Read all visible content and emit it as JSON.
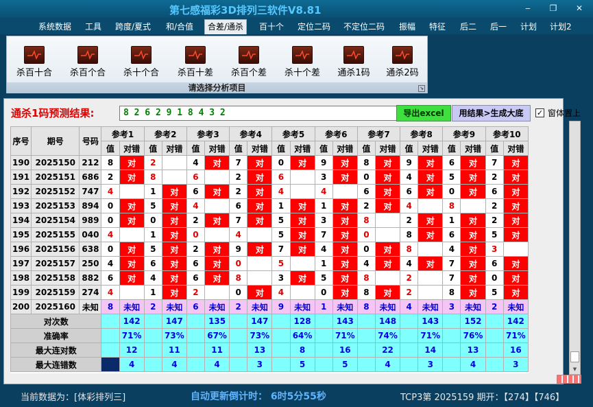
{
  "window": {
    "title": "第七感福彩3D排列三软件V8.81",
    "min_glyph": "‒",
    "restore_glyph": "❐",
    "close_glyph": "✕"
  },
  "menu": [
    {
      "label": "系统数据"
    },
    {
      "label": "工具"
    },
    {
      "label": "跨度/夏式"
    },
    {
      "label": "和/合值"
    },
    {
      "label": "合差/通杀",
      "active": true
    },
    {
      "label": "百十个"
    },
    {
      "label": "定位二码"
    },
    {
      "label": "不定位二码"
    },
    {
      "label": "振幅"
    },
    {
      "label": "特征"
    },
    {
      "label": "后二"
    },
    {
      "label": "后一"
    },
    {
      "label": "计划"
    },
    {
      "label": "计划2"
    }
  ],
  "ribbon": {
    "buttons": [
      {
        "label": "杀百十合",
        "icon": "chart-icon"
      },
      {
        "label": "杀百个合",
        "icon": "chart-icon"
      },
      {
        "label": "杀十个合",
        "icon": "chart-icon"
      },
      {
        "label": "杀百十差",
        "icon": "chart-icon"
      },
      {
        "label": "杀百个差",
        "icon": "chart-icon"
      },
      {
        "label": "杀十个差",
        "icon": "chart-icon"
      },
      {
        "label": "通杀1码",
        "icon": "chart-icon"
      },
      {
        "label": "通杀2码",
        "icon": "chart-icon"
      }
    ],
    "group_label": "请选择分析项目",
    "launcher_glyph": "↘"
  },
  "prediction": {
    "label": "通杀1码预测结果:",
    "value": "8  2  6  2  9  1  8  4  3  2"
  },
  "buttons": {
    "excel": "导出excel",
    "generate": "用结果>生成大底"
  },
  "topmost": {
    "label": "窗体置上",
    "checked": "✓"
  },
  "grid": {
    "headers": {
      "seq": "序号",
      "period": "期号",
      "number": "号码",
      "val": "值",
      "result": "对错"
    },
    "refs": [
      "参考1",
      "参考2",
      "参考3",
      "参考4",
      "参考5",
      "参考6",
      "参考7",
      "参考8",
      "参考9",
      "参考10"
    ],
    "rows": [
      {
        "seq": "190",
        "period": "2025150",
        "num": "212",
        "cells": [
          [
            "8",
            "对"
          ],
          [
            "2",
            ""
          ],
          [
            "4",
            "对"
          ],
          [
            "7",
            "对"
          ],
          [
            "0",
            "对"
          ],
          [
            "9",
            "对"
          ],
          [
            "8",
            "对"
          ],
          [
            "9",
            "对"
          ],
          [
            "6",
            "对"
          ],
          [
            "7",
            "对"
          ]
        ]
      },
      {
        "seq": "191",
        "period": "2025151",
        "num": "686",
        "cells": [
          [
            "2",
            "对"
          ],
          [
            "8",
            ""
          ],
          [
            "6",
            ""
          ],
          [
            "2",
            "对"
          ],
          [
            "6",
            ""
          ],
          [
            "3",
            "对"
          ],
          [
            "0",
            "对"
          ],
          [
            "4",
            "对"
          ],
          [
            "5",
            "对"
          ],
          [
            "2",
            "对"
          ]
        ]
      },
      {
        "seq": "192",
        "period": "2025152",
        "num": "747",
        "cells": [
          [
            "4",
            ""
          ],
          [
            "1",
            "对"
          ],
          [
            "6",
            "对"
          ],
          [
            "2",
            "对"
          ],
          [
            "4",
            ""
          ],
          [
            "4",
            ""
          ],
          [
            "6",
            "对"
          ],
          [
            "6",
            "对"
          ],
          [
            "0",
            "对"
          ],
          [
            "6",
            "对"
          ]
        ]
      },
      {
        "seq": "193",
        "period": "2025153",
        "num": "894",
        "cells": [
          [
            "0",
            "对"
          ],
          [
            "5",
            "对"
          ],
          [
            "4",
            ""
          ],
          [
            "6",
            "对"
          ],
          [
            "1",
            "对"
          ],
          [
            "1",
            "对"
          ],
          [
            "2",
            "对"
          ],
          [
            "4",
            ""
          ],
          [
            "8",
            ""
          ],
          [
            "2",
            "对"
          ]
        ]
      },
      {
        "seq": "194",
        "period": "2025154",
        "num": "989",
        "cells": [
          [
            "0",
            "对"
          ],
          [
            "0",
            "对"
          ],
          [
            "2",
            "对"
          ],
          [
            "7",
            "对"
          ],
          [
            "5",
            "对"
          ],
          [
            "3",
            "对"
          ],
          [
            "8",
            ""
          ],
          [
            "2",
            "对"
          ],
          [
            "1",
            "对"
          ],
          [
            "2",
            "对"
          ]
        ]
      },
      {
        "seq": "195",
        "period": "2025155",
        "num": "040",
        "cells": [
          [
            "4",
            ""
          ],
          [
            "1",
            "对"
          ],
          [
            "0",
            ""
          ],
          [
            "4",
            ""
          ],
          [
            "5",
            "对"
          ],
          [
            "7",
            "对"
          ],
          [
            "0",
            ""
          ],
          [
            "8",
            "对"
          ],
          [
            "6",
            "对"
          ],
          [
            "5",
            "对"
          ]
        ]
      },
      {
        "seq": "196",
        "period": "2025156",
        "num": "638",
        "cells": [
          [
            "0",
            "对"
          ],
          [
            "5",
            "对"
          ],
          [
            "2",
            "对"
          ],
          [
            "9",
            "对"
          ],
          [
            "7",
            "对"
          ],
          [
            "4",
            "对"
          ],
          [
            "0",
            "对"
          ],
          [
            "8",
            ""
          ],
          [
            "4",
            "对"
          ],
          [
            "3",
            ""
          ]
        ]
      },
      {
        "seq": "197",
        "period": "2025157",
        "num": "250",
        "cells": [
          [
            "4",
            "对"
          ],
          [
            "6",
            "对"
          ],
          [
            "6",
            "对"
          ],
          [
            "0",
            ""
          ],
          [
            "5",
            ""
          ],
          [
            "1",
            "对"
          ],
          [
            "4",
            "对"
          ],
          [
            "4",
            "对"
          ],
          [
            "7",
            "对"
          ],
          [
            "6",
            "对"
          ]
        ]
      },
      {
        "seq": "198",
        "period": "2025158",
        "num": "882",
        "cells": [
          [
            "6",
            "对"
          ],
          [
            "4",
            "对"
          ],
          [
            "6",
            "对"
          ],
          [
            "8",
            ""
          ],
          [
            "3",
            "对"
          ],
          [
            "5",
            "对"
          ],
          [
            "8",
            ""
          ],
          [
            "2",
            ""
          ],
          [
            "7",
            "对"
          ],
          [
            "0",
            "对"
          ]
        ]
      },
      {
        "seq": "199",
        "period": "2025159",
        "num": "274",
        "cells": [
          [
            "4",
            ""
          ],
          [
            "1",
            "对"
          ],
          [
            "2",
            ""
          ],
          [
            "0",
            "对"
          ],
          [
            "4",
            ""
          ],
          [
            "0",
            "对"
          ],
          [
            "8",
            "对"
          ],
          [
            "2",
            ""
          ],
          [
            "8",
            "对"
          ],
          [
            "5",
            "对"
          ]
        ]
      },
      {
        "seq": "200",
        "period": "2025160",
        "num": "未知",
        "unknown": true,
        "cells": [
          [
            "8",
            "未知"
          ],
          [
            "2",
            "未知"
          ],
          [
            "6",
            "未知"
          ],
          [
            "2",
            "未知"
          ],
          [
            "9",
            "未知"
          ],
          [
            "1",
            "未知"
          ],
          [
            "8",
            "未知"
          ],
          [
            "4",
            "未知"
          ],
          [
            "3",
            "未知"
          ],
          [
            "2",
            "未知"
          ]
        ]
      }
    ],
    "stats": [
      {
        "label": "对次数",
        "values": [
          "142",
          "147",
          "135",
          "147",
          "128",
          "143",
          "148",
          "143",
          "152",
          "142"
        ]
      },
      {
        "label": "准确率",
        "values": [
          "71%",
          "73%",
          "67%",
          "73%",
          "64%",
          "71%",
          "74%",
          "71%",
          "76%",
          "71%"
        ]
      },
      {
        "label": "最大连对数",
        "values": [
          "12",
          "11",
          "11",
          "13",
          "8",
          "16",
          "22",
          "14",
          "13",
          "16"
        ]
      },
      {
        "label": "最大连错数",
        "values": [
          "4",
          "4",
          "4",
          "3",
          "5",
          "5",
          "4",
          "3",
          "4",
          "3"
        ]
      }
    ]
  },
  "status": {
    "current_data": "当前数据为：[体彩排列三]",
    "countdown": "自动更新倒计时： 6时5分55秒",
    "latest": "TCP3第 2025159 期开：【274】【746】"
  },
  "colors": {
    "hit": "#ff0000",
    "unknown_row": "#f5c6f5",
    "stats_bg": "#80ffff",
    "prediction_text": "#008000"
  }
}
